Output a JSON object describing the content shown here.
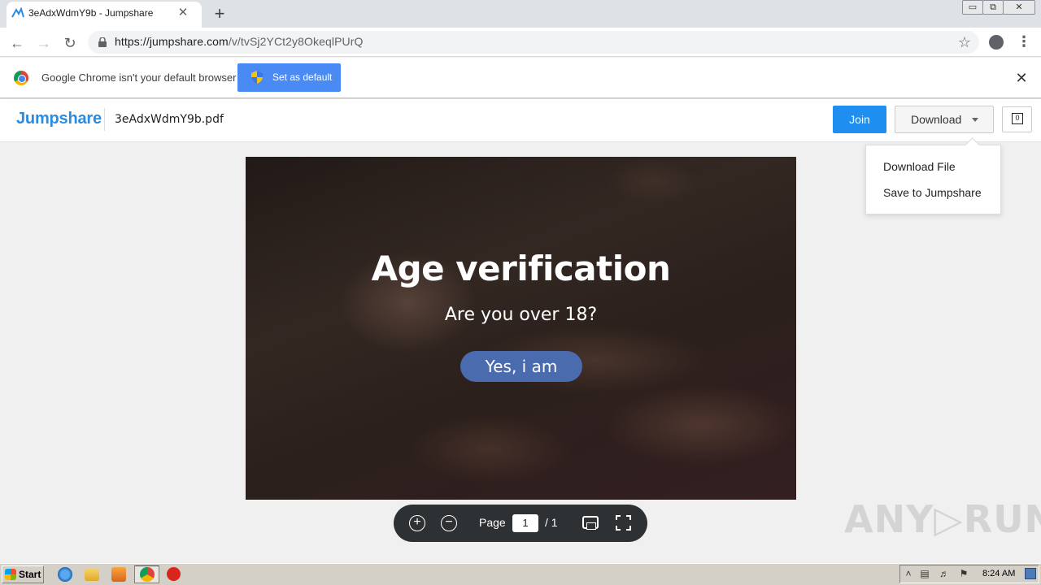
{
  "browser": {
    "tab_title": "3eAdxWdmY9b - Jumpshare",
    "tab_close": "✕",
    "new_tab": "+",
    "window_controls": [
      "▭",
      "⧉",
      "✕"
    ],
    "url_host": "https://jumpshare.com",
    "url_path": "/v/tvSj2YCt2y8OkeqlPUrQ",
    "infobar_text": "Google Chrome isn't your default browser",
    "set_default_label": "Set as default",
    "infobar_close": "✕"
  },
  "jumpshare": {
    "logo": "Jumpshare",
    "file_name": "3eAdxWdmY9b.pdf",
    "join_label": "Join",
    "download_label": "Download",
    "comment_count": "0",
    "dropdown_items": [
      "Download File",
      "Save to Jumpshare"
    ]
  },
  "document": {
    "title": "Age verification",
    "question": "Are you over 18?",
    "button": "Yes, i am"
  },
  "viewer": {
    "zoom_in": "+",
    "zoom_out": "−",
    "page_label": "Page",
    "page_current": "1",
    "page_total": "/ 1"
  },
  "watermark": "ANY▷RUN",
  "taskbar": {
    "start_label": "Start",
    "clock": "8:24 AM"
  },
  "colors": {
    "jumpshare_blue": "#2a8ce0",
    "join_button": "#1e8ff0",
    "set_default_button": "#4a8af4",
    "verify_button": "#4a6cae"
  }
}
